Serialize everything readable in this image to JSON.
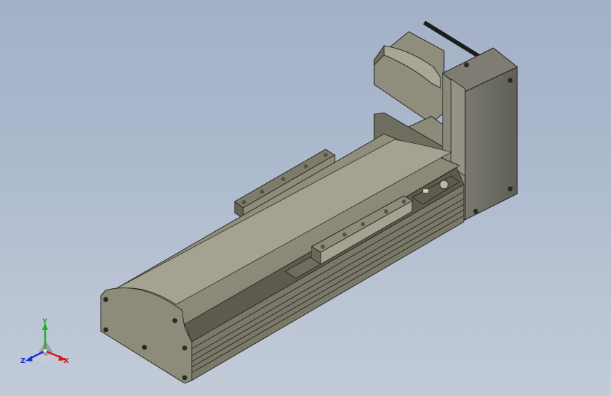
{
  "viewport": {
    "background_top": "#a3b0c5",
    "background_bottom": "#c3cbd8"
  },
  "model": {
    "body_color": "#8c8a78",
    "motor_color": "#6d6c65"
  },
  "triad": {
    "x_label": "X",
    "y_label": "Y",
    "z_label": "Z",
    "x_color": "#d11a1a",
    "y_color": "#20b020",
    "z_color": "#1a2fd0"
  }
}
